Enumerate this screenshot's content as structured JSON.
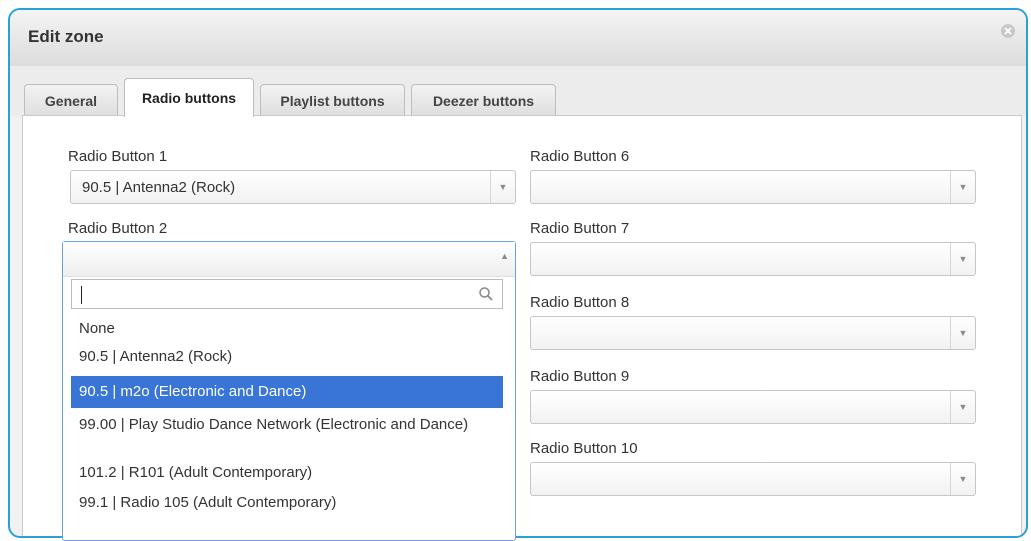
{
  "dialog": {
    "title": "Edit zone"
  },
  "tabs": [
    {
      "label": "General",
      "active": false
    },
    {
      "label": "Radio buttons",
      "active": true
    },
    {
      "label": "Playlist buttons",
      "active": false
    },
    {
      "label": "Deezer buttons",
      "active": false
    }
  ],
  "radio1": {
    "label": "Radio Button 1",
    "value": "90.5 | Antenna2 (Rock)"
  },
  "radio2": {
    "label": "Radio Button 2",
    "search_value": "",
    "options": [
      {
        "text": "None",
        "selected": false
      },
      {
        "text": "90.5 | Antenna2 (Rock)",
        "selected": false
      },
      {
        "text": "90.5 | m2o (Electronic and Dance)",
        "selected": true
      },
      {
        "text": "99.00 | Play Studio Dance Network (Electronic and Dance)",
        "selected": false
      },
      {
        "text": "101.2 | R101 (Adult Contemporary)",
        "selected": false
      },
      {
        "text": "99.1 | Radio 105 (Adult Contemporary)",
        "selected": false
      }
    ]
  },
  "radio6": {
    "label": "Radio Button 6",
    "value": ""
  },
  "radio7": {
    "label": "Radio Button 7",
    "value": ""
  },
  "radio8": {
    "label": "Radio Button 8",
    "value": ""
  },
  "radio9": {
    "label": "Radio Button 9",
    "value": ""
  },
  "radio10": {
    "label": "Radio Button 10",
    "value": ""
  },
  "colors": {
    "accent_border": "#2aa0d8",
    "selection": "#3875d7"
  }
}
